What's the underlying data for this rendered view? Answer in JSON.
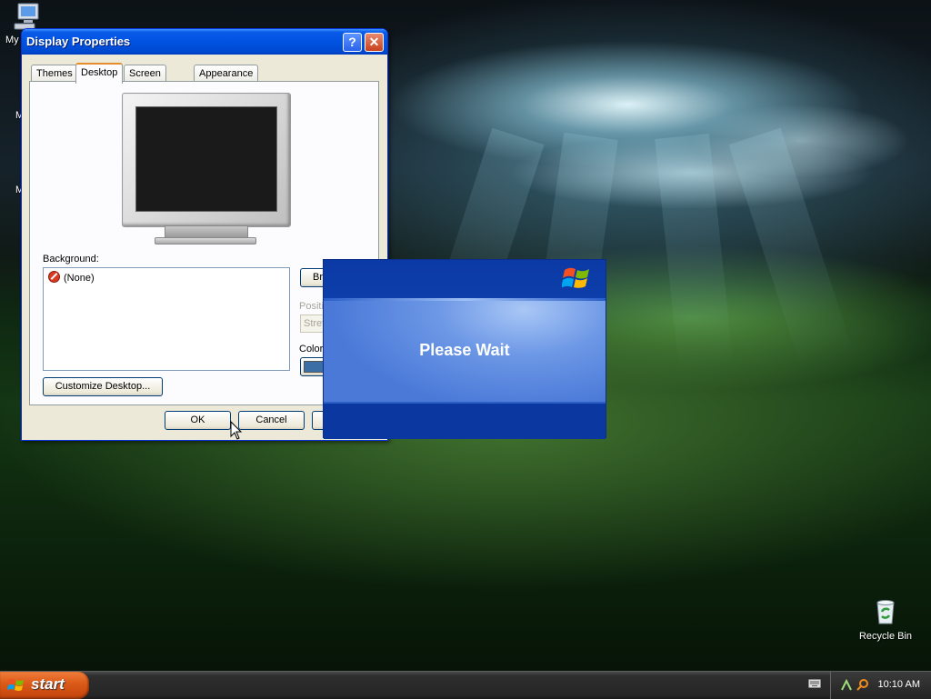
{
  "desktop": {
    "icons": [
      {
        "name": "my-computer",
        "label": "My"
      },
      {
        "name": "recycle-bin",
        "label": "Recycle Bin"
      }
    ],
    "partial_labels": [
      "M",
      "M"
    ]
  },
  "display_properties": {
    "title": "Display Properties",
    "help_glyph": "?",
    "close_glyph": "✕",
    "tabs": [
      {
        "label": "Themes",
        "active": false
      },
      {
        "label": "Desktop",
        "active": true
      },
      {
        "label": "Screen Saver",
        "active": false
      },
      {
        "label": "Appearance",
        "active": false
      }
    ],
    "background_label": "Background:",
    "background_items": [
      "(None)"
    ],
    "browse_label": "Br",
    "position_label": "Positi",
    "position_value": "Stret",
    "color_label": "Color:",
    "color_value": "#3a6ea5",
    "customize_label": "Customize Desktop...",
    "ok_label": "OK",
    "cancel_label": "Cancel",
    "apply_label": ""
  },
  "wait_dialog": {
    "message": "Please Wait"
  },
  "taskbar": {
    "start_label": "start",
    "clock": "10:10 AM"
  },
  "colors": {
    "titlebar": "#0053e1",
    "start_button": "#dd5c1a",
    "wait_dialog": "#0e3ba5"
  }
}
